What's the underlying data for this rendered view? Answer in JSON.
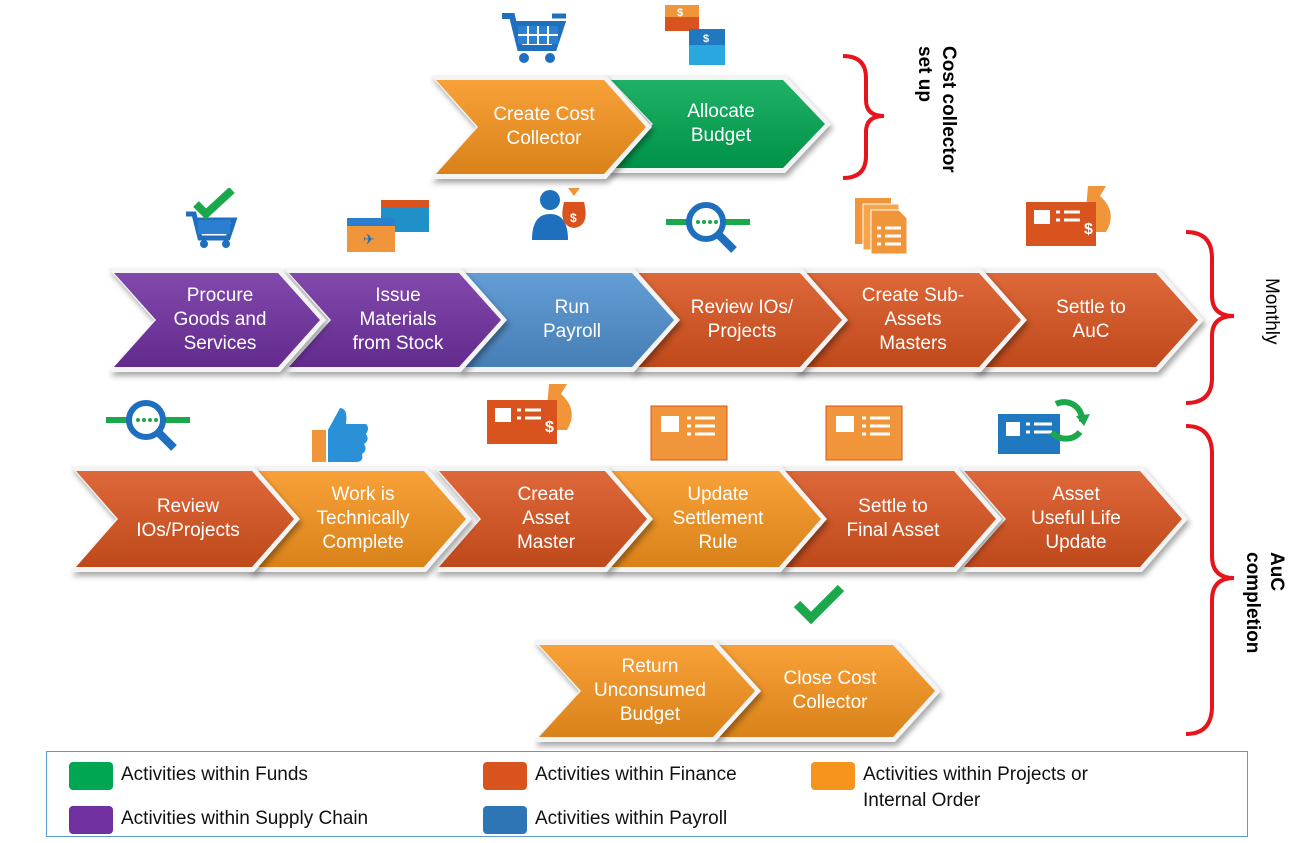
{
  "colors": {
    "funds": "#00a651",
    "finance": "#d9531e",
    "projects": "#f7941d",
    "supply_chain": "#7030a0",
    "payroll": "#2e75b6",
    "payroll_step": "#4f8fcf",
    "brace": "#e8141c"
  },
  "phases": {
    "setup": "Cost collector\nset up",
    "monthly": "Monthly",
    "completion": "AuC\ncompletion"
  },
  "rows": [
    [
      {
        "label": "Create Cost\nCollector",
        "category": "projects",
        "icon": "shopping-cart-icon"
      },
      {
        "label": "Allocate\nBudget",
        "category": "funds",
        "icon": "dollar-blocks-icon"
      }
    ],
    [
      {
        "label": "Procure\nGoods and\nServices",
        "category": "supply_chain",
        "icon": "cart-check-icon"
      },
      {
        "label": "Issue\nMaterials\nfrom Stock",
        "category": "supply_chain",
        "icon": "shipping-boxes-icon"
      },
      {
        "label": "Run\nPayroll",
        "category": "payroll",
        "icon": "person-money-bag-icon"
      },
      {
        "label": "Review IOs/\nProjects",
        "category": "finance",
        "icon": "magnifier-icon"
      },
      {
        "label": "Create Sub-\nAssets\nMasters",
        "category": "finance",
        "icon": "documents-icon"
      },
      {
        "label": "Settle to\nAuC",
        "category": "finance",
        "icon": "asset-card-money-icon"
      }
    ],
    [
      {
        "label": "Review\nIOs/Projects",
        "category": "finance",
        "icon": "magnifier-icon"
      },
      {
        "label": "Work is\nTechnically\nComplete",
        "category": "projects",
        "icon": "thumbs-up-icon"
      },
      {
        "label": "Create\nAsset\nMaster",
        "category": "finance",
        "icon": "asset-card-money-icon"
      },
      {
        "label": "Update\nSettlement\nRule",
        "category": "projects",
        "icon": "asset-card-icon"
      },
      {
        "label": "Settle to\nFinal Asset",
        "category": "finance",
        "icon": "asset-card-icon"
      },
      {
        "label": "Asset\nUseful Life\nUpdate",
        "category": "finance",
        "icon": "card-refresh-icon"
      }
    ],
    [
      {
        "label": "Return\nUnconsumed\nBudget",
        "category": "projects",
        "icon": ""
      },
      {
        "label": "Close Cost\nCollector",
        "category": "projects",
        "icon": "checkmark-icon"
      }
    ]
  ],
  "legend": [
    {
      "label": "Activities within Funds",
      "category": "funds"
    },
    {
      "label": "Activities within Finance",
      "category": "finance"
    },
    {
      "label": "Activities within Projects or\nInternal Order",
      "category": "projects"
    },
    {
      "label": "Activities within Supply Chain",
      "category": "supply_chain"
    },
    {
      "label": "Activities within Payroll",
      "category": "payroll"
    }
  ]
}
